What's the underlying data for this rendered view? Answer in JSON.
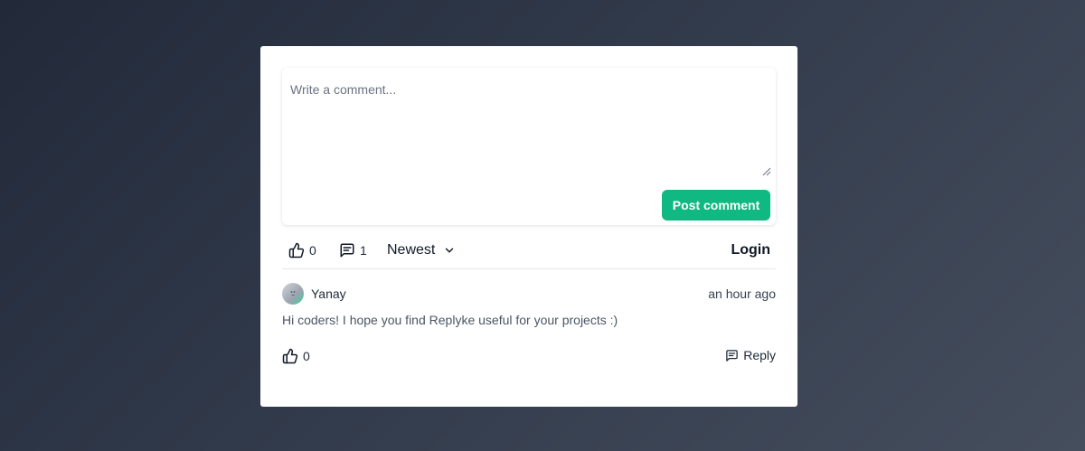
{
  "composer": {
    "placeholder": "Write a comment...",
    "value": "",
    "post_label": "Post comment"
  },
  "toolbar": {
    "likes_count": "0",
    "comments_count": "1",
    "sort_label": "Newest",
    "login_label": "Login"
  },
  "comments": [
    {
      "author": "Yanay",
      "time": "an hour ago",
      "text": "Hi coders! I hope you find Replyke useful for your projects :)",
      "likes_count": "0",
      "reply_label": "Reply"
    }
  ],
  "icons": {
    "like": "thumbs-up-icon",
    "comments": "comment-bubble-icon",
    "sort": "chevron-down-icon",
    "reply": "reply-icon",
    "resize": "resize-handle-icon"
  },
  "colors": {
    "accent": "#10b981",
    "card": "#ffffff",
    "background": "#2b3343"
  }
}
